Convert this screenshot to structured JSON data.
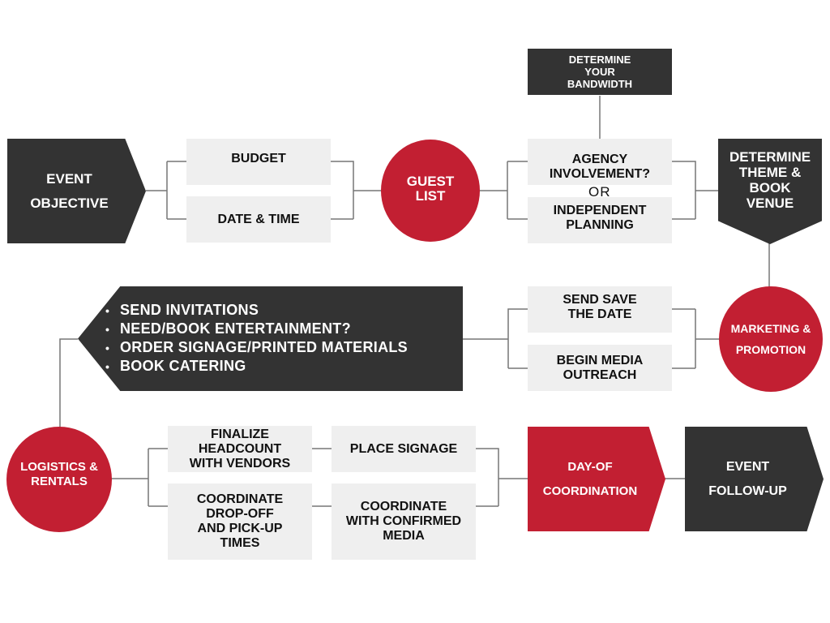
{
  "diagram": {
    "nodes": {
      "event_objective": "EVENT\nOBJECTIVE",
      "budget": "BUDGET",
      "date_time": "DATE & TIME",
      "guest_list": "GUEST\nLIST",
      "bandwidth": "DETERMINE\nYOUR\nBANDWIDTH",
      "agency": "AGENCY\nINVOLVEMENT?",
      "or_label": "OR",
      "independent": "INDEPENDENT\nPLANNING",
      "theme_venue": "DETERMINE\nTHEME &\nBOOK\nVENUE",
      "marketing": "MARKETING &\nPROMOTION",
      "save_date": "SEND SAVE\nTHE DATE",
      "media_outreach": "BEGIN MEDIA\nOUTREACH",
      "tasks": [
        "SEND INVITATIONS",
        "NEED/BOOK ENTERTAINMENT?",
        "ORDER SIGNAGE/PRINTED MATERIALS",
        "BOOK CATERING"
      ],
      "logistics": "LOGISTICS &\nRENTALS",
      "headcount": "FINALIZE\nHEADCOUNT\nWITH VENDORS",
      "dropoff": "COORDINATE\nDROP-OFF\nAND PICK-UP\nTIMES",
      "signage": "PLACE SIGNAGE",
      "confirmed_media": "COORDINATE\nWITH CONFIRMED\nMEDIA",
      "day_of": "DAY-OF\nCOORDINATION",
      "follow_up": "EVENT\nFOLLOW-UP"
    },
    "colors": {
      "red": "#c21f32",
      "dark": "#333333",
      "gray": "#efefef",
      "connector": "#777777"
    }
  }
}
